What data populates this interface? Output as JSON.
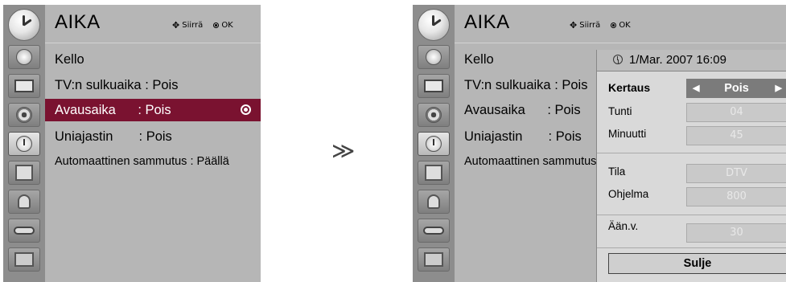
{
  "menu": {
    "title": "AIKA",
    "hint_move": "Siirrä",
    "hint_ok": "OK",
    "items": [
      {
        "label": "Kello"
      },
      {
        "label": "TV:n sulkuaika : Pois"
      },
      {
        "label": "Avausaika      : Pois"
      },
      {
        "label": "Uniajastin       : Pois"
      },
      {
        "label": "Automaattinen sammutus : Päällä"
      }
    ]
  },
  "menu_right": {
    "items": [
      {
        "label": "Kello"
      },
      {
        "label": "TV:n sulkuaika : Pois"
      },
      {
        "label": "Avausaika      : Pois"
      },
      {
        "label": "Uniajastin       : Pois"
      },
      {
        "label": "Automaattinen sammutus"
      }
    ]
  },
  "sidebar": {
    "icons": [
      "picture-icon",
      "screen-icon",
      "audio-icon",
      "time-icon",
      "option-icon",
      "lock-icon",
      "input-icon",
      "photo-icon"
    ],
    "active": "time-icon"
  },
  "arrow": "≫",
  "dialog": {
    "datetime": "1/Mar. 2007 16:09",
    "repeat_label": "Kertaus",
    "repeat_value": "Pois",
    "hour_label": "Tunti",
    "hour_value": "04",
    "minute_label": "Minuutti",
    "minute_value": "45",
    "mode_label": "Tila",
    "mode_value": "DTV",
    "program_label": "Ohjelma",
    "program_value": "800",
    "volume_label": "Ään.v.",
    "volume_value": "30",
    "close_label": "Sulje"
  },
  "colors": {
    "selected_bg": "#7a1230",
    "panel_bg": "#b6b6b6",
    "sidebar_bg": "#8d8d8d"
  }
}
